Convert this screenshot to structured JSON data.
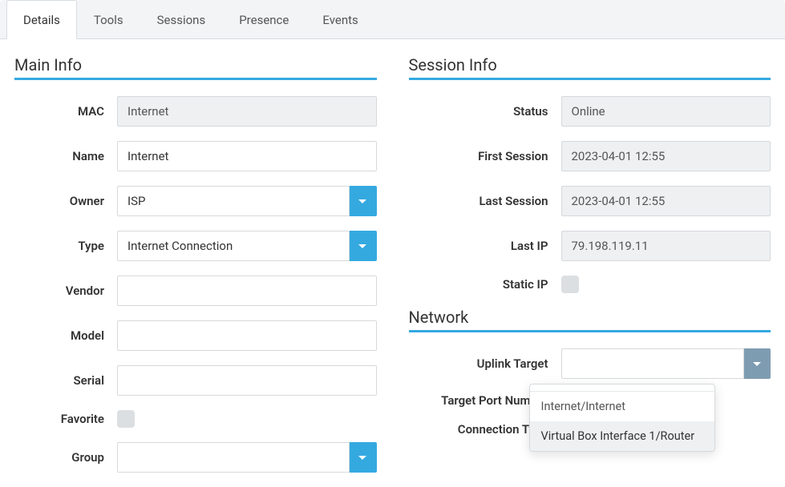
{
  "tabs": {
    "details": "Details",
    "tools": "Tools",
    "sessions": "Sessions",
    "presence": "Presence",
    "events": "Events"
  },
  "sections": {
    "main": "Main Info",
    "session": "Session Info",
    "network": "Network"
  },
  "main": {
    "mac_label": "MAC",
    "mac_value": "Internet",
    "name_label": "Name",
    "name_value": "Internet",
    "owner_label": "Owner",
    "owner_value": "ISP",
    "type_label": "Type",
    "type_value": "Internet Connection",
    "vendor_label": "Vendor",
    "vendor_value": "",
    "model_label": "Model",
    "model_value": "",
    "serial_label": "Serial",
    "serial_value": "",
    "favorite_label": "Favorite",
    "group_label": "Group",
    "group_value": ""
  },
  "session": {
    "status_label": "Status",
    "status_value": "Online",
    "first_label": "First Session",
    "first_value": "2023-04-01   12:55",
    "last_label": "Last Session",
    "last_value": "2023-04-01   12:55",
    "lastip_label": "Last IP",
    "lastip_value": "79.198.119.11",
    "staticip_label": "Static IP"
  },
  "network": {
    "uplink_label": "Uplink Target",
    "uplink_value": "",
    "port_label": "Target Port Number",
    "conn_label": "Connection Type",
    "dropdown": {
      "opt1": "Internet/Internet",
      "opt2": "Virtual Box Interface 1/Router"
    }
  }
}
